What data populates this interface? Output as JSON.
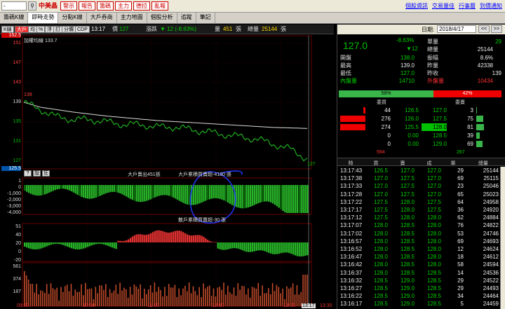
{
  "toolbar": {
    "combo": "-",
    "stock_name": "中美晶",
    "red_buttons": [
      "警示",
      "報告",
      "籌碼",
      "主力",
      "德拉",
      "亂報"
    ],
    "links": [
      "個股資訊",
      "交易量佳",
      "行事曆",
      "到價通知"
    ]
  },
  "tabs": [
    {
      "label": "籌碼K線",
      "active": false
    },
    {
      "label": "即時走勢",
      "active": true
    },
    {
      "label": "分點K線",
      "active": false
    },
    {
      "label": "大戶券商",
      "active": false
    },
    {
      "label": "主力地圖",
      "active": false
    },
    {
      "label": "個股分析",
      "active": false
    },
    {
      "label": "追蹤",
      "active": false
    },
    {
      "label": "筆記",
      "active": false
    }
  ],
  "chart_header": {
    "mini_buttons": [
      "K線",
      "大戶",
      "均",
      "%",
      "浮",
      "訂",
      "分價",
      "CDP"
    ],
    "time": "13:17",
    "price_label": "價",
    "price": "127",
    "change_label": "漲跌",
    "change": "▼ 12 (-8.63%)",
    "volume_label": "量",
    "volume": "451",
    "volume_unit": "張",
    "total_label": "總量",
    "total": "25144",
    "total_unit": "張"
  },
  "price_chart": {
    "legend": "加權均線 133.7",
    "y_labels": [
      "152.5",
      "151",
      "147",
      "143",
      "139",
      "135",
      "131",
      "127",
      "125.5"
    ],
    "start_price": "139",
    "end_price": "127"
  },
  "panel_buttons": [
    "?",
    "設",
    "狂"
  ],
  "indicator1": {
    "label1": "大戶賣出451張",
    "label2": "大戶累積買賣超-4180 張",
    "y_labels": [
      "1",
      "0",
      "-1,000",
      "-2,000",
      "-3,000",
      "-4,000"
    ]
  },
  "indicator2": {
    "label": "散戶累積買賣超-30 張",
    "y_labels": [
      "51",
      "40",
      "20",
      "0",
      "-20"
    ]
  },
  "volume_panel": {
    "y_labels": [
      "561",
      "374",
      "187"
    ]
  },
  "x_labels": [
    "09:00",
    "10:00",
    "11:00",
    "12:00",
    "13:00",
    "13:17",
    "13:30"
  ],
  "chart_data": {
    "type": "line",
    "title": "",
    "xlabel": "",
    "ylabel": "",
    "x_range": [
      "09:00",
      "13:30"
    ],
    "ylim": [
      125.5,
      152.5
    ],
    "series": [
      {
        "values": [
          139,
          137.5,
          136,
          135.5,
          135.5,
          135,
          134.5,
          134.5,
          134,
          134,
          133.5,
          133,
          132.5,
          132,
          131.5,
          130.5,
          129.5,
          127.5
        ]
      },
      {
        "name": "加權均線",
        "values": [
          139,
          138,
          137.5,
          137,
          136.6,
          136.2,
          135.9,
          135.6,
          135.3,
          135.1,
          134.9,
          134.7,
          134.5,
          134.3,
          134.1,
          133.9,
          133.8,
          133.7
        ]
      }
    ]
  },
  "date_bar": {
    "label": "日期:",
    "value": "2018/4/17",
    "buttons": [
      "<<",
      ">>"
    ]
  },
  "quote": {
    "price": "127.0",
    "change_pct": "-8.63%",
    "change": "▼12",
    "fields": [
      {
        "label": "單量",
        "value": "29"
      },
      {
        "label": "總量",
        "value": "25144"
      },
      {
        "label": "開盤",
        "value": "138.0"
      },
      {
        "label": "振幅",
        "value": "8.6%"
      },
      {
        "label": "最高",
        "value": "139.0"
      },
      {
        "label": "昨量",
        "value": "42338"
      },
      {
        "label": "最低",
        "value": "127.0"
      },
      {
        "label": "昨收",
        "value": "139"
      },
      {
        "label": "內盤量",
        "value": "14710"
      },
      {
        "label": "外盤量",
        "value": "10434"
      }
    ],
    "buy_ratio_label": "58%",
    "sell_ratio_label": "42%",
    "buy_ratio": 0.58
  },
  "orderbook": {
    "header_bid": "委買",
    "header_ask": "委賣",
    "rows": [
      {
        "bid_vol": "44",
        "bid": "126.5",
        "ask": "127.0",
        "ask_vol": "3",
        "bid_bar": 0.07,
        "ask_bar": 0.02
      },
      {
        "bid_vol": "276",
        "bid": "126.0",
        "ask": "127.5",
        "ask_vol": "75",
        "bid_bar": 0.9,
        "ask_bar": 0.25
      },
      {
        "bid_vol": "274",
        "bid": "125.5",
        "ask": "128.0",
        "ask_vol": "81",
        "bid_bar": 0.9,
        "ask_bar": 0.27
      },
      {
        "bid_vol": "0",
        "bid": "0.00",
        "ask": "128.5",
        "ask_vol": "39",
        "bid_bar": 0,
        "ask_bar": 0.13
      },
      {
        "bid_vol": "0",
        "bid": "0.00",
        "ask": "129.0",
        "ask_vol": "69",
        "bid_bar": 0,
        "ask_bar": 0.23
      }
    ],
    "bid_total": "594",
    "ask_total": "267"
  },
  "ticks": {
    "headers": [
      "時",
      "買",
      "賣",
      "成",
      "單",
      "總量"
    ],
    "rows": [
      {
        "time": "13:17:43",
        "bid": "126.5",
        "ask": "127.0",
        "price": "127.0",
        "vol": "29",
        "total": "25144"
      },
      {
        "time": "13:17:38",
        "bid": "127.0",
        "ask": "127.5",
        "price": "127.0",
        "vol": "69",
        "total": "25115"
      },
      {
        "time": "13:17:33",
        "bid": "127.0",
        "ask": "127.5",
        "price": "127.0",
        "vol": "23",
        "total": "25046"
      },
      {
        "time": "13:17:28",
        "bid": "127.0",
        "ask": "127.5",
        "price": "127.0",
        "vol": "65",
        "total": "25023"
      },
      {
        "time": "13:17:22",
        "bid": "127.5",
        "ask": "128.0",
        "price": "127.5",
        "vol": "64",
        "total": "24958"
      },
      {
        "time": "13:17:17",
        "bid": "127.5",
        "ask": "128.0",
        "price": "127.5",
        "vol": "36",
        "total": "24920"
      },
      {
        "time": "13:17:12",
        "bid": "127.5",
        "ask": "128.0",
        "price": "128.0",
        "vol": "62",
        "total": "24884"
      },
      {
        "time": "13:17:07",
        "bid": "128.0",
        "ask": "128.5",
        "price": "128.0",
        "vol": "76",
        "total": "24822"
      },
      {
        "time": "13:17:02",
        "bid": "128.0",
        "ask": "128.5",
        "price": "128.0",
        "vol": "53",
        "total": "24746"
      },
      {
        "time": "13:16:57",
        "bid": "128.0",
        "ask": "128.5",
        "price": "128.0",
        "vol": "69",
        "total": "24693"
      },
      {
        "time": "13:16:52",
        "bid": "128.0",
        "ask": "128.5",
        "price": "128.0",
        "vol": "12",
        "total": "24624"
      },
      {
        "time": "13:16:47",
        "bid": "128.0",
        "ask": "128.5",
        "price": "128.0",
        "vol": "18",
        "total": "24612"
      },
      {
        "time": "13:16:42",
        "bid": "128.0",
        "ask": "128.5",
        "price": "128.0",
        "vol": "58",
        "total": "24594"
      },
      {
        "time": "13:16:37",
        "bid": "128.0",
        "ask": "128.5",
        "price": "128.5",
        "vol": "14",
        "total": "24536"
      },
      {
        "time": "13:16:32",
        "bid": "128.5",
        "ask": "129.0",
        "price": "128.5",
        "vol": "29",
        "total": "24522"
      },
      {
        "time": "13:16:27",
        "bid": "128.5",
        "ask": "129.0",
        "price": "128.5",
        "vol": "29",
        "total": "24493"
      },
      {
        "time": "13:16:22",
        "bid": "128.5",
        "ask": "129.0",
        "price": "128.5",
        "vol": "34",
        "total": "24464"
      },
      {
        "time": "13:16:17",
        "bid": "128.5",
        "ask": "129.0",
        "price": "128.5",
        "vol": "5",
        "total": "24459"
      }
    ]
  }
}
